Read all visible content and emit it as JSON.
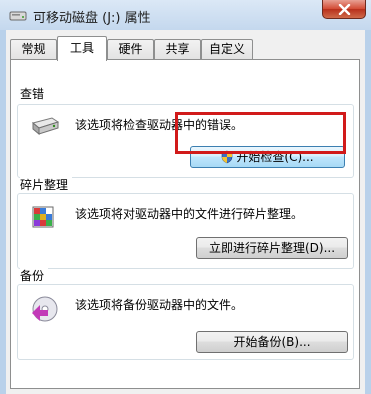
{
  "window": {
    "title": "可移动磁盘 (J:) 属性",
    "icon": "drive-icon"
  },
  "tabs": [
    {
      "label": "常规",
      "active": false
    },
    {
      "label": "工具",
      "active": true
    },
    {
      "label": "硬件",
      "active": false
    },
    {
      "label": "共享",
      "active": false
    },
    {
      "label": "自定义",
      "active": false
    }
  ],
  "groups": {
    "error_check": {
      "title": "查错",
      "description": "该选项将检查驱动器中的错误。",
      "button": "开始检查(C)...",
      "icon": "hard-drive-icon"
    },
    "defrag": {
      "title": "碎片整理",
      "description": "该选项将对驱动器中的文件进行碎片整理。",
      "button": "立即进行碎片整理(D)...",
      "icon": "defragment-icon"
    },
    "backup": {
      "title": "备份",
      "description": "该选项将备份驱动器中的文件。",
      "button": "开始备份(B)...",
      "icon": "backup-icon"
    }
  },
  "colors": {
    "highlight_box": "#d11a1a",
    "window_frame": "#b9d1ea",
    "close_button": "#d24a33"
  }
}
